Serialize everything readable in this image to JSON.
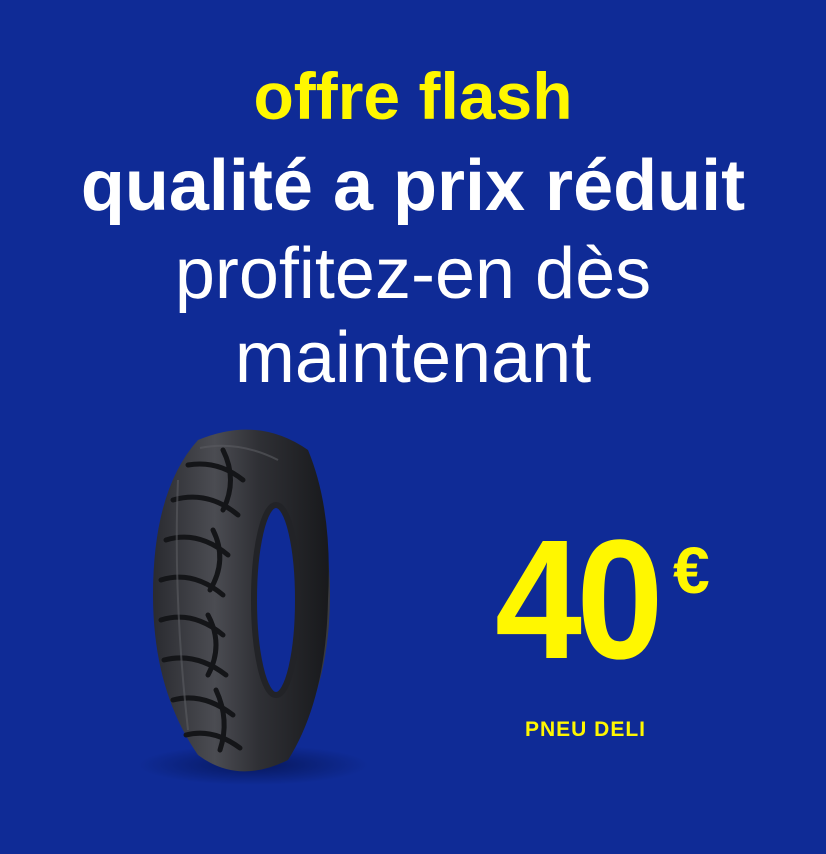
{
  "ad": {
    "line1": "offre flash",
    "line2": "qualité a prix réduit",
    "line3": "profitez-en dès",
    "line4": "maintenant"
  },
  "price": {
    "amount": "40",
    "currency": "€"
  },
  "product": {
    "name": "PNEU DELI"
  },
  "image": {
    "icon": "motorcycle-tire-icon"
  },
  "colors": {
    "background": "#0f2b96",
    "accent": "#fff700",
    "text": "#ffffff"
  }
}
